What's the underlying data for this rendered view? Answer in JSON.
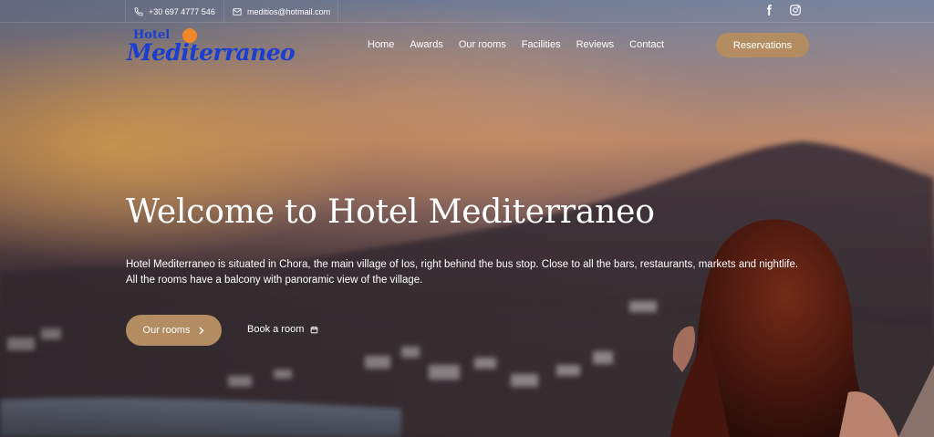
{
  "topbar": {
    "phone": "+30 697 4777 546",
    "email": "meditios@hotmail.com",
    "social": [
      "facebook-icon",
      "instagram-icon"
    ]
  },
  "brand": {
    "logo_small": "Hotel",
    "logo_main": "Mediterraneo",
    "colors": {
      "logo_blue": "#1a3fd0",
      "logo_orange": "#f0872a"
    }
  },
  "nav": {
    "items": [
      "Home",
      "Awards",
      "Our rooms",
      "Facilities",
      "Reviews",
      "Contact"
    ],
    "reservations_label": "Reservations"
  },
  "hero": {
    "title": "Welcome to Hotel Mediterraneo",
    "text_line1": "Hotel Mediterraneo is situated in Chora, the main village of Ios, right behind the bus stop. Close to all the bars, restaurants, markets and nightlife.",
    "text_line2": "All the rooms have a balcony with panoramic view of the village.",
    "primary_button": "Our rooms",
    "secondary_link": "Book a room"
  },
  "colors": {
    "accent": "#b38d61",
    "text": "#ffffff"
  }
}
